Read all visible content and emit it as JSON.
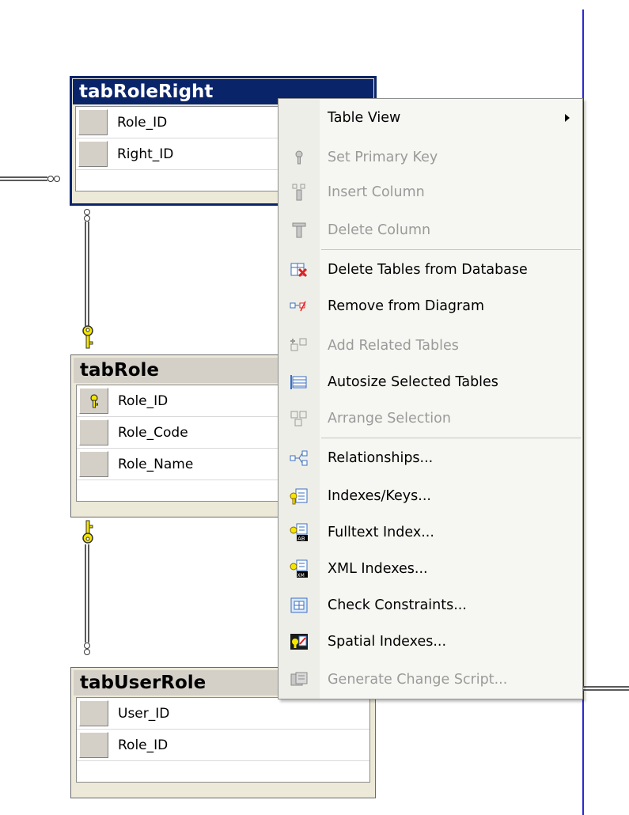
{
  "tables": {
    "roleright": {
      "title": "tabRoleRight",
      "columns": [
        "Role_ID",
        "Right_ID"
      ]
    },
    "role": {
      "title": "tabRole",
      "columns": [
        "Role_ID",
        "Role_Code",
        "Role_Name"
      ]
    },
    "userrole": {
      "title": "tabUserRole",
      "columns": [
        "User_ID",
        "Role_ID"
      ]
    }
  },
  "menu": {
    "items": [
      {
        "label": "Table View",
        "icon": "none",
        "disabled": false,
        "submenu": true
      },
      {
        "label": "Set Primary Key",
        "icon": "key-icon",
        "disabled": true
      },
      {
        "label": "Insert Column",
        "icon": "insert-column-icon",
        "disabled": true
      },
      {
        "label": "Delete Column",
        "icon": "delete-column-icon",
        "disabled": true
      },
      {
        "label": "Delete Tables from Database",
        "icon": "delete-table-icon",
        "disabled": false
      },
      {
        "label": "Remove from Diagram",
        "icon": "remove-diagram-icon",
        "disabled": false
      },
      {
        "label": "Add Related Tables",
        "icon": "add-related-icon",
        "disabled": true
      },
      {
        "label": "Autosize Selected Tables",
        "icon": "autosize-icon",
        "disabled": false
      },
      {
        "label": "Arrange Selection",
        "icon": "arrange-icon",
        "disabled": true
      },
      {
        "label": "Relationships...",
        "icon": "relationships-icon",
        "disabled": false
      },
      {
        "label": "Indexes/Keys...",
        "icon": "indexes-icon",
        "disabled": false
      },
      {
        "label": "Fulltext Index...",
        "icon": "fulltext-icon",
        "disabled": false
      },
      {
        "label": "XML Indexes...",
        "icon": "xml-index-icon",
        "disabled": false
      },
      {
        "label": "Check Constraints...",
        "icon": "check-constraint-icon",
        "disabled": false
      },
      {
        "label": "Spatial Indexes...",
        "icon": "spatial-index-icon",
        "disabled": false
      },
      {
        "label": "Generate Change Script...",
        "icon": "script-icon",
        "disabled": true
      }
    ]
  },
  "colors": {
    "selected_title": "#0a246a",
    "page_line": "#2a2ad0",
    "key_yellow": "#f5e600"
  }
}
